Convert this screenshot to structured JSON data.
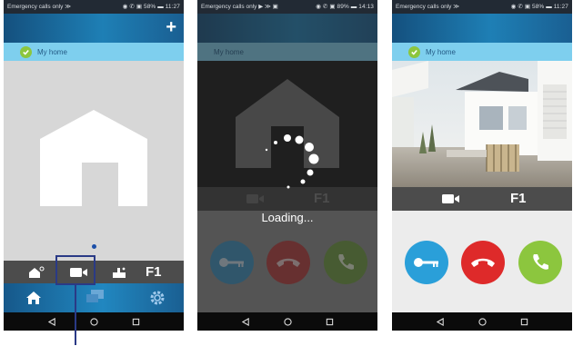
{
  "screen1": {
    "status_left": "Emergency calls only ≫",
    "status_right": "◉ ✆ ▣ 58% ▬ 11:27",
    "add_label": "+",
    "home_label": "My home",
    "floor_label": "F1"
  },
  "screen2": {
    "status_left": "Emergency calls only ▶ ≫ ▣",
    "status_right": "◉ ✆ ▣ 89% ▬ 14:13",
    "home_label": "My home",
    "floor_label": "F1",
    "loading_text": "Loading..."
  },
  "screen3": {
    "status_left": "Emergency calls only ≫",
    "status_right": "◉ ✆ ▣ 58% ▬ 11:27",
    "home_label": "My home",
    "floor_label": "F1"
  },
  "colors": {
    "key_button": "#2a9fd9",
    "hangup_button": "#de2a2a",
    "answer_button": "#8cc63e",
    "accent_blue": "#1e7fb5",
    "home_bar": "#7ecfee"
  },
  "icons": [
    "plus-icon",
    "check-icon",
    "house-icon",
    "video-camera-icon",
    "doorbell-icon",
    "home-icon",
    "messages-icon",
    "settings-gear-icon",
    "key-icon",
    "hangup-phone-icon",
    "answer-phone-icon",
    "back-icon",
    "circle-home-icon",
    "recent-apps-icon"
  ]
}
